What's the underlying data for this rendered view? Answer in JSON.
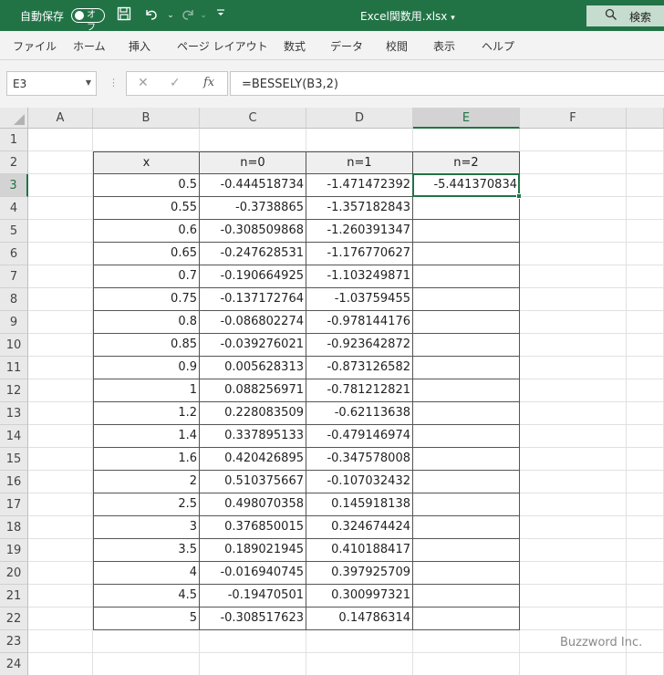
{
  "titlebar": {
    "autosave_label": "自動保存",
    "autosave_state": "オフ",
    "filename": "Excel関数用.xlsx",
    "search_label": "検索"
  },
  "menu": [
    "ファイル",
    "ホーム",
    "挿入",
    "ページ レイアウト",
    "数式",
    "データ",
    "校閲",
    "表示",
    "ヘルプ"
  ],
  "formula_bar": {
    "name_box": "E3",
    "formula": "=BESSELY(B3,2)"
  },
  "columns": [
    "A",
    "B",
    "C",
    "D",
    "E",
    "F"
  ],
  "rows": [
    "1",
    "2",
    "3",
    "4",
    "5",
    "6",
    "7",
    "8",
    "9",
    "10",
    "11",
    "12",
    "13",
    "14",
    "15",
    "16",
    "17",
    "18",
    "19",
    "20",
    "21",
    "22",
    "23",
    "24"
  ],
  "active_cell": "E3",
  "table": {
    "headers": [
      "x",
      "n=0",
      "n=1",
      "n=2"
    ],
    "rows": [
      [
        "0.5",
        "-0.444518734",
        "-1.471472392",
        "-5.441370834"
      ],
      [
        "0.55",
        "-0.3738865",
        "-1.357182843",
        ""
      ],
      [
        "0.6",
        "-0.308509868",
        "-1.260391347",
        ""
      ],
      [
        "0.65",
        "-0.247628531",
        "-1.176770627",
        ""
      ],
      [
        "0.7",
        "-0.190664925",
        "-1.103249871",
        ""
      ],
      [
        "0.75",
        "-0.137172764",
        "-1.03759455",
        ""
      ],
      [
        "0.8",
        "-0.086802274",
        "-0.978144176",
        ""
      ],
      [
        "0.85",
        "-0.039276021",
        "-0.923642872",
        ""
      ],
      [
        "0.9",
        "0.005628313",
        "-0.873126582",
        ""
      ],
      [
        "1",
        "0.088256971",
        "-0.781212821",
        ""
      ],
      [
        "1.2",
        "0.228083509",
        "-0.62113638",
        ""
      ],
      [
        "1.4",
        "0.337895133",
        "-0.479146974",
        ""
      ],
      [
        "1.6",
        "0.420426895",
        "-0.347578008",
        ""
      ],
      [
        "2",
        "0.510375667",
        "-0.107032432",
        ""
      ],
      [
        "2.5",
        "0.498070358",
        "0.145918138",
        ""
      ],
      [
        "3",
        "0.376850015",
        "0.324674424",
        ""
      ],
      [
        "3.5",
        "0.189021945",
        "0.410188417",
        ""
      ],
      [
        "4",
        "-0.016940745",
        "0.397925709",
        ""
      ],
      [
        "4.5",
        "-0.19470501",
        "0.300997321",
        ""
      ],
      [
        "5",
        "-0.308517623",
        "0.14786314",
        ""
      ]
    ]
  },
  "watermark": "Buzzword Inc.",
  "colors": {
    "accent": "#217346",
    "search_bg": "#c6dccf"
  },
  "icons": [
    "save-icon",
    "undo-icon",
    "redo-icon",
    "customize-icon",
    "search-icon",
    "cancel-icon",
    "enter-icon",
    "function-icon"
  ]
}
